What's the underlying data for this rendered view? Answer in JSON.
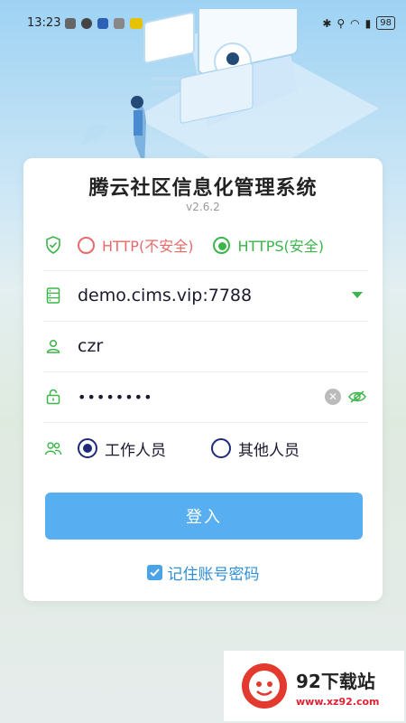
{
  "status_bar": {
    "time": "13:23",
    "battery": "98"
  },
  "app": {
    "title": "腾云社区信息化管理系统",
    "version": "v2.6.2"
  },
  "protocol": {
    "options": [
      {
        "label": "HTTP(不安全)",
        "selected": false,
        "color": "#e86a6a"
      },
      {
        "label": "HTTPS(安全)",
        "selected": true,
        "color": "#3cb54a"
      }
    ]
  },
  "server": {
    "value": "demo.cims.vip:7788"
  },
  "username": {
    "value": "czr"
  },
  "password": {
    "value": "••••••••"
  },
  "user_type": {
    "options": [
      {
        "label": "工作人员",
        "selected": true
      },
      {
        "label": "其他人员",
        "selected": false
      }
    ]
  },
  "login_button": {
    "label": "登入"
  },
  "remember": {
    "label": "记住账号密码",
    "checked": true
  },
  "watermark": {
    "name": "92下载站",
    "url": "www.xz92.com"
  },
  "colors": {
    "accent": "#57aef0",
    "navy": "#1e2a78",
    "icon_green": "#3cb54a"
  }
}
